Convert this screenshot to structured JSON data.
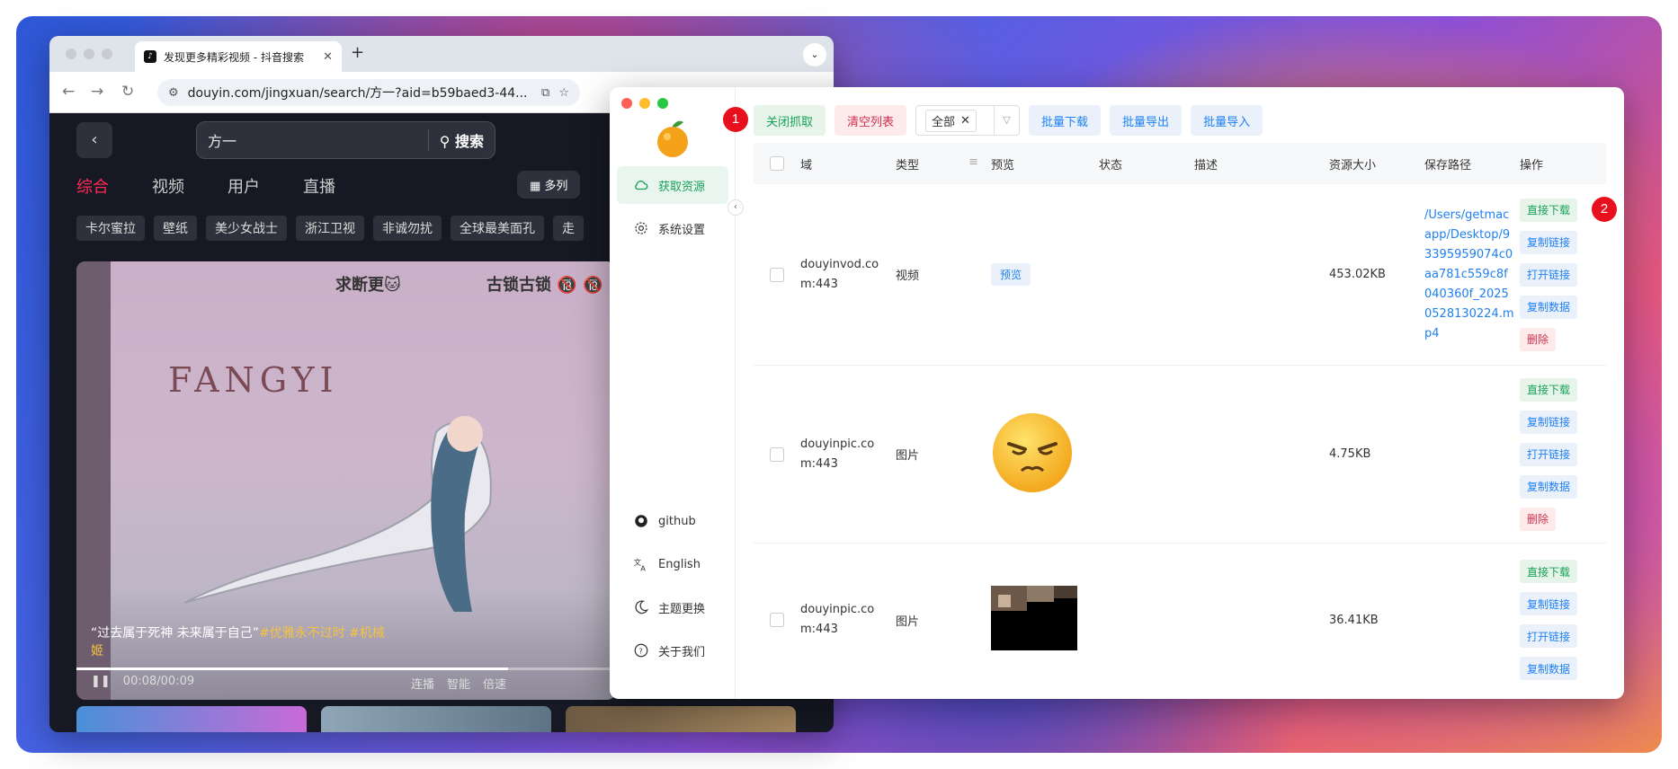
{
  "browser": {
    "tab_title": "发现更多精彩视频 - 抖音搜索",
    "url": "douyin.com/jingxuan/search/方一?aid=b59baed3-44...",
    "page": {
      "search_value": "方一",
      "search_button": "搜索",
      "tabs": [
        "综合",
        "视频",
        "用户",
        "直播"
      ],
      "multi_column": "多列",
      "chips": [
        "卡尔蜜拉",
        "壁纸",
        "美少女战士",
        "浙江卫视",
        "非诚勿扰",
        "全球最美面孔",
        "走"
      ],
      "video": {
        "overlay_text_1": "求断更🐱",
        "overlay_text_2": "古锁古锁 🔞 🔞",
        "brand": "FANGYI",
        "caption_main": "“过去属于死神 未来属于自己”",
        "caption_tags": "#优雅永不过时  #机械姬",
        "time_current": "00:08",
        "time_total": "00:09",
        "controls": [
          "连播",
          "智能",
          "倍速"
        ],
        "progress": 0.8
      }
    }
  },
  "app": {
    "sidebar": {
      "items": [
        {
          "label": "获取资源",
          "icon": "cloud-icon"
        },
        {
          "label": "系统设置",
          "icon": "gear-icon"
        },
        {
          "label": "github",
          "icon": "github-icon"
        },
        {
          "label": "English",
          "icon": "translate-icon"
        },
        {
          "label": "主题更换",
          "icon": "moon-icon"
        },
        {
          "label": "关于我们",
          "icon": "help-icon"
        }
      ]
    },
    "toolbar": {
      "close_capture": "关闭抓取",
      "clear_list": "清空列表",
      "filter_value": "全部",
      "batch_download": "批量下载",
      "batch_export": "批量导出",
      "batch_import": "批量导入"
    },
    "table": {
      "headers": [
        "域",
        "类型",
        "预览",
        "状态",
        "描述",
        "资源大小",
        "保存路径",
        "操作"
      ],
      "rows": [
        {
          "domain": "douyinvod.com:443",
          "type": "视频",
          "preview": "预览",
          "status": "",
          "desc": "",
          "size": "453.02KB",
          "path": "/Users/getmacapp/Desktop/93395959074c0aa781c559c8f040360f_20250528130224.mp4",
          "ops": [
            "直接下载",
            "复制链接",
            "打开链接",
            "复制数据",
            "删除"
          ]
        },
        {
          "domain": "douyinpic.com:443",
          "type": "图片",
          "preview": "",
          "status": "",
          "desc": "",
          "size": "4.75KB",
          "path": "",
          "ops": [
            "直接下载",
            "复制链接",
            "打开链接",
            "复制数据",
            "删除"
          ]
        },
        {
          "domain": "douyinpic.com:443",
          "type": "图片",
          "preview": "",
          "status": "",
          "desc": "",
          "size": "36.41KB",
          "path": "",
          "ops": [
            "直接下载",
            "复制链接",
            "打开链接",
            "复制数据"
          ]
        }
      ]
    },
    "badges": [
      "1",
      "2"
    ]
  },
  "colors": {
    "accent_green": "#18a058",
    "accent_blue": "#2080f0",
    "accent_red": "#d03050",
    "douyin_red": "#fe2c55",
    "badge_red": "#e8101c"
  }
}
